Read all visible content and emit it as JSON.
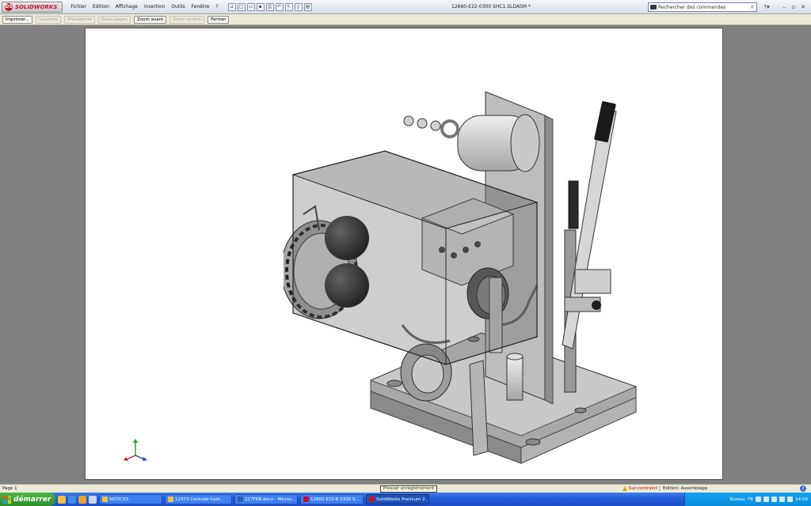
{
  "app": {
    "logo_text": "SOLIDWORKS",
    "document_title": "12660-E22-0300 SHC1.SLDASM *"
  },
  "menu": [
    "Fichier",
    "Edition",
    "Affichage",
    "Insertion",
    "Outils",
    "Fenêtre",
    "?"
  ],
  "search": {
    "placeholder": "Rechercher des commandes"
  },
  "print_preview": {
    "buttons": [
      {
        "label": "Imprimer...",
        "enabled": true
      },
      {
        "label": "Suivante",
        "enabled": false
      },
      {
        "label": "Précédente",
        "enabled": false
      },
      {
        "label": "Deux pages",
        "enabled": false
      },
      {
        "label": "Zoom avant",
        "enabled": true
      },
      {
        "label": "Zoom arrière",
        "enabled": false
      },
      {
        "label": "Fermer",
        "enabled": true
      }
    ]
  },
  "status": {
    "page": "Page 1",
    "tooltip": "Presser enregistrement",
    "under_defined": "Sur-contraint",
    "mode": "Edition: Assemblage"
  },
  "taskbar": {
    "start_label": "démarrer",
    "tasks": [
      {
        "label": "NOTICES",
        "color": "#f0c040",
        "active": false
      },
      {
        "label": "12473 Centrale hydr...",
        "color": "#f0c040",
        "active": false
      },
      {
        "label": "227FRB.docx - Micros...",
        "color": "#2b5fb4",
        "active": false
      },
      {
        "label": "12660-E22-B 0300 S...",
        "color": "#c8102e",
        "active": false
      },
      {
        "label": "SolidWorks Premium 2...",
        "color": "#c8102e",
        "active": true
      }
    ],
    "tray_lang": "FR",
    "tray_label": "Bureau",
    "clock": "14:08"
  },
  "colors": {
    "workspace": "#808080",
    "accent_red": "#c8102e",
    "taskbar_blue": "#245edb"
  }
}
